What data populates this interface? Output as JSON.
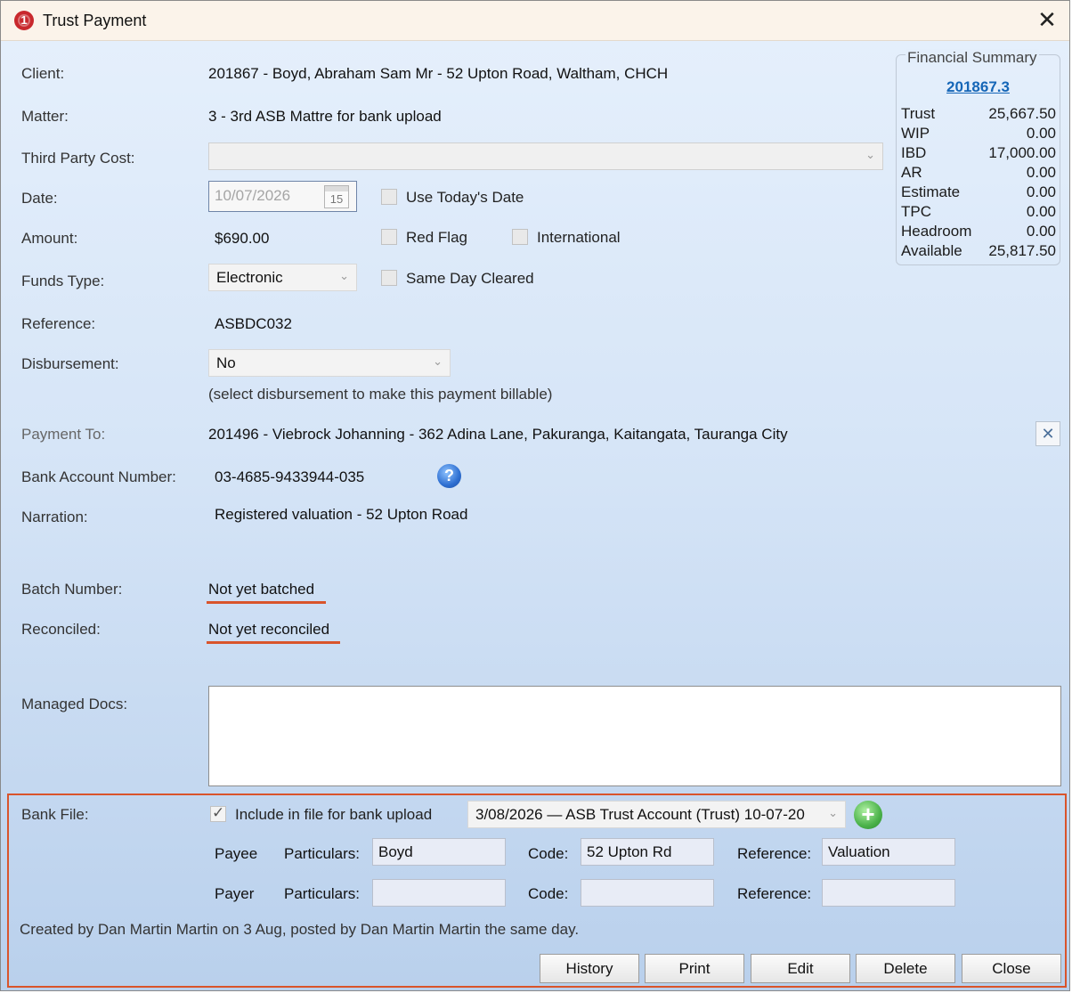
{
  "window": {
    "title": "Trust Payment",
    "close_glyph": "✕"
  },
  "labels": {
    "client": "Client:",
    "matter": "Matter:",
    "third_party_cost": "Third Party Cost:",
    "date": "Date:",
    "amount": "Amount:",
    "funds_type": "Funds Type:",
    "reference": "Reference:",
    "disbursement": "Disbursement:",
    "payment_to": "Payment To:",
    "bank_account_number": "Bank Account Number:",
    "narration": "Narration:",
    "batch_number": "Batch Number:",
    "reconciled": "Reconciled:",
    "managed_docs": "Managed Docs:",
    "bank_file": "Bank File:"
  },
  "values": {
    "client": "201867 - Boyd, Abraham Sam Mr - 52 Upton Road, Waltham, CHCH",
    "matter": "3 - 3rd ASB Mattre for bank upload",
    "third_party_cost": "",
    "date": "10/07/2026",
    "calendar_day": "15",
    "amount": "$690.00",
    "funds_type": "Electronic",
    "reference": "ASBDC032",
    "disbursement": "No",
    "disbursement_hint": "(select disbursement to make this payment billable)",
    "payment_to": "201496 - Viebrock Johanning - 362 Adina Lane, Pakuranga, Kaitangata, Tauranga City",
    "bank_account_number": "03-4685-9433944-035",
    "narration": "Registered valuation - 52 Upton Road",
    "batch_number": "Not yet batched",
    "reconciled": "Not yet reconciled"
  },
  "checkboxes": {
    "use_today": {
      "label": "Use Today's Date",
      "checked": false
    },
    "red_flag": {
      "label": "Red Flag",
      "checked": false
    },
    "international": {
      "label": "International",
      "checked": false
    },
    "same_day_cleared": {
      "label": "Same Day Cleared",
      "checked": false
    },
    "include_bank_upload": {
      "label": "Include in file for bank upload",
      "checked": true
    }
  },
  "financial_summary": {
    "legend": "Financial Summary",
    "link": "201867.3",
    "rows": [
      {
        "k": "Trust",
        "v": "25,667.50"
      },
      {
        "k": "WIP",
        "v": "0.00"
      },
      {
        "k": "IBD",
        "v": "17,000.00"
      },
      {
        "k": "AR",
        "v": "0.00"
      },
      {
        "k": "Estimate",
        "v": "0.00"
      },
      {
        "k": "TPC",
        "v": "0.00"
      },
      {
        "k": "Headroom",
        "v": "0.00"
      },
      {
        "k": "Available",
        "v": "25,817.50"
      }
    ]
  },
  "bank_file": {
    "batch_select": "3/08/2026 — ASB Trust Account (Trust) 10-07-20",
    "payee": {
      "row_label": "Payee",
      "particulars_label": "Particulars:",
      "particulars": "Boyd",
      "code_label": "Code:",
      "code": "52 Upton Rd",
      "reference_label": "Reference:",
      "reference": "Valuation"
    },
    "payer": {
      "row_label": "Payer",
      "particulars_label": "Particulars:",
      "particulars": "",
      "code_label": "Code:",
      "code": "",
      "reference_label": "Reference:",
      "reference": ""
    },
    "audit": "Created by Dan Martin Martin on 3 Aug, posted by Dan Martin Martin the same day."
  },
  "icons": {
    "help": "?",
    "plus": "+",
    "clear": "✕",
    "caret": "⌄"
  },
  "buttons": {
    "history": "History",
    "print": "Print",
    "edit": "Edit",
    "delete": "Delete",
    "close": "Close"
  },
  "colors": {
    "accent_highlight": "#d9542b",
    "link": "#1566b7"
  }
}
